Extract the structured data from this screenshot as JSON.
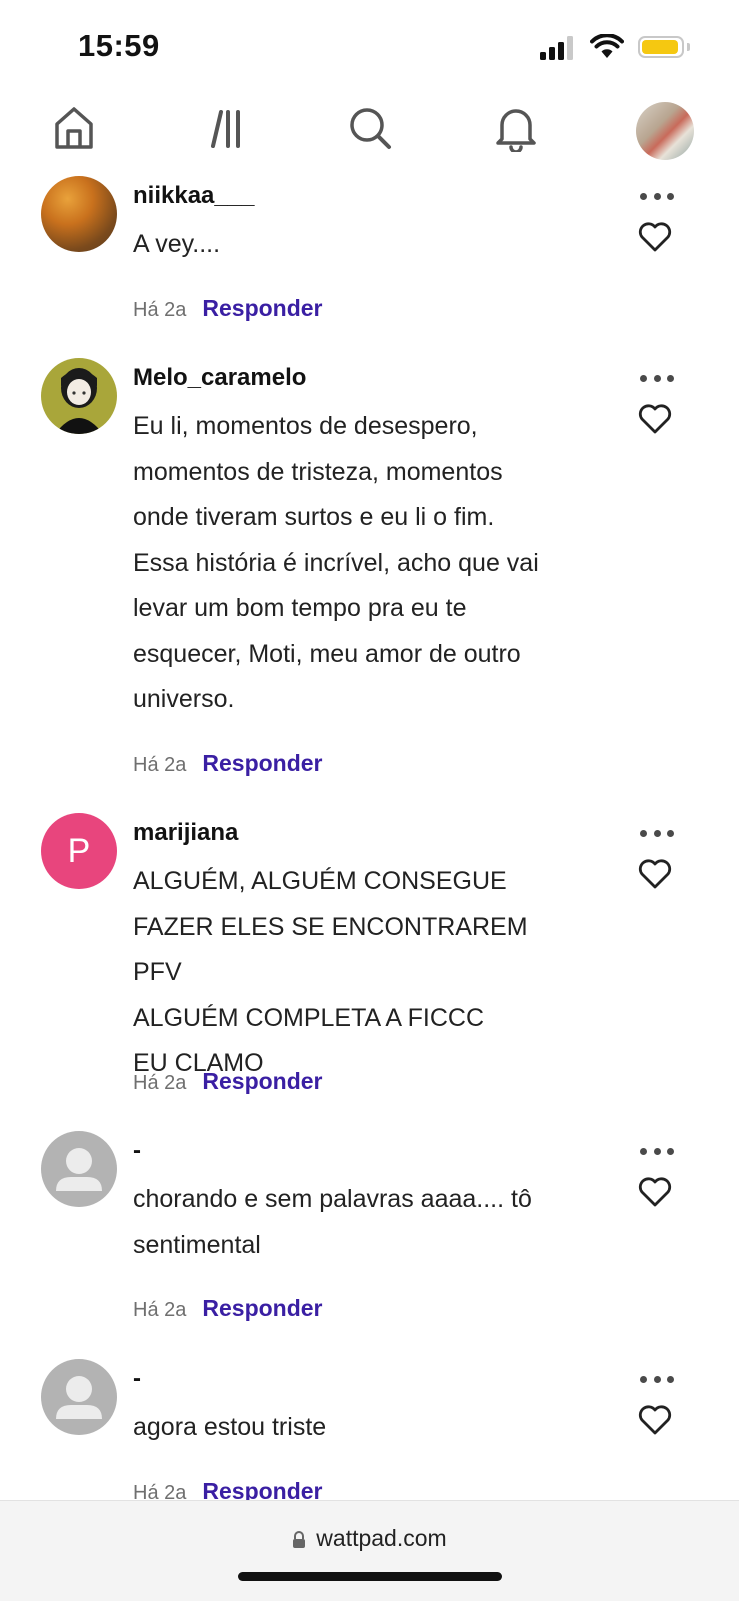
{
  "status_bar": {
    "time": "15:59"
  },
  "nav": {
    "items": [
      {
        "name": "home-icon"
      },
      {
        "name": "library-icon"
      },
      {
        "name": "search-icon"
      },
      {
        "name": "notifications-icon"
      }
    ]
  },
  "comments": [
    {
      "username": "niikkaa___",
      "text": "A vey....",
      "time": "Há 2a",
      "reply": "Responder"
    },
    {
      "username": "Melo_caramelo",
      "text": "Eu li, momentos de desespero,\nmomentos de tristeza, momentos\nonde tiveram surtos e eu li o fim.\nEssa história é incrível, acho que vai\nlevar um bom tempo pra eu te\nesquecer, Moti, meu amor de outro\nuniverso.",
      "time": "Há 2a",
      "reply": "Responder"
    },
    {
      "username": "marijiana",
      "avatar_letter": "P",
      "text": "ALGUÉM, ALGUÉM CONSEGUE\nFAZER ELES SE ENCONTRAREM PFV\nALGUÉM COMPLETA A FICCC\nEU CLAMO",
      "time": "Há 2a",
      "reply": "Responder"
    },
    {
      "username": "-",
      "text": "chorando e sem palavras aaaa.... tô\nsentimental",
      "time": "Há 2a",
      "reply": "Responder"
    },
    {
      "username": "-",
      "text": "agora estou triste",
      "time": "Há 2a",
      "reply": "Responder"
    }
  ],
  "browser": {
    "url": "wattpad.com"
  },
  "colors": {
    "reply": "#3a1fa3",
    "avatar_pink": "#e8457d",
    "avatar_gray": "#b3b3b3"
  }
}
